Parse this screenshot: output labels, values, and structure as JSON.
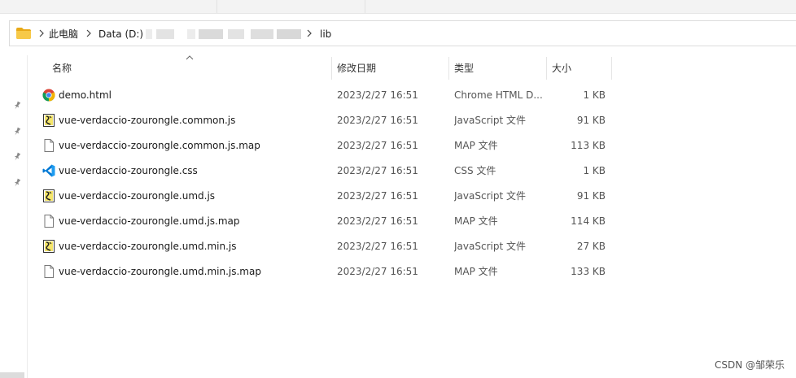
{
  "breadcrumb": {
    "items": [
      "此电脑",
      "Data (D:)",
      "lib"
    ]
  },
  "columns": {
    "name": "名称",
    "date": "修改日期",
    "type": "类型",
    "size": "大小"
  },
  "files": [
    {
      "name": "demo.html",
      "date": "2023/2/27 16:51",
      "type": "Chrome HTML D...",
      "size": "1 KB",
      "icon": "chrome-icon"
    },
    {
      "name": "vue-verdaccio-zourongle.common.js",
      "date": "2023/2/27 16:51",
      "type": "JavaScript 文件",
      "size": "91 KB",
      "icon": "javascript-file-icon"
    },
    {
      "name": "vue-verdaccio-zourongle.common.js.map",
      "date": "2023/2/27 16:51",
      "type": "MAP 文件",
      "size": "113 KB",
      "icon": "generic-file-icon"
    },
    {
      "name": "vue-verdaccio-zourongle.css",
      "date": "2023/2/27 16:51",
      "type": "CSS 文件",
      "size": "1 KB",
      "icon": "vscode-icon"
    },
    {
      "name": "vue-verdaccio-zourongle.umd.js",
      "date": "2023/2/27 16:51",
      "type": "JavaScript 文件",
      "size": "91 KB",
      "icon": "javascript-file-icon"
    },
    {
      "name": "vue-verdaccio-zourongle.umd.js.map",
      "date": "2023/2/27 16:51",
      "type": "MAP 文件",
      "size": "114 KB",
      "icon": "generic-file-icon"
    },
    {
      "name": "vue-verdaccio-zourongle.umd.min.js",
      "date": "2023/2/27 16:51",
      "type": "JavaScript 文件",
      "size": "27 KB",
      "icon": "javascript-file-icon"
    },
    {
      "name": "vue-verdaccio-zourongle.umd.min.js.map",
      "date": "2023/2/27 16:51",
      "type": "MAP 文件",
      "size": "133 KB",
      "icon": "generic-file-icon"
    }
  ],
  "watermark": "CSDN @邹荣乐",
  "colors": {
    "folder": "#f2c14e",
    "chrome_red": "#db4437",
    "chrome_yellow": "#f4b400",
    "chrome_green": "#0f9d58",
    "chrome_blue": "#4285f4",
    "vscode_blue": "#0078d4"
  }
}
